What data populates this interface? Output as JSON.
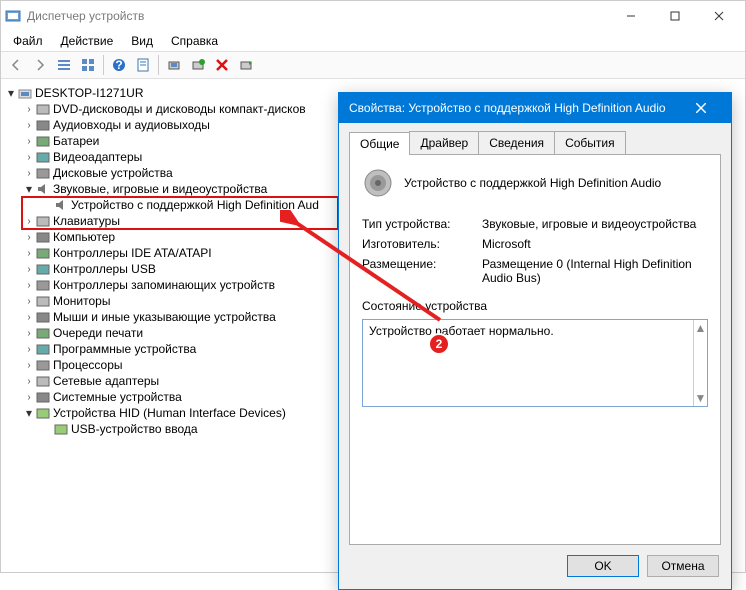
{
  "window": {
    "title": "Диспетчер устройств"
  },
  "menu": {
    "file": "Файл",
    "action": "Действие",
    "view": "Вид",
    "help": "Справка"
  },
  "tree": {
    "root": "DESKTOP-I1271UR",
    "items": [
      "DVD-дисководы и дисководы компакт-дисков",
      "Аудиовходы и аудиовыходы",
      "Батареи",
      "Видеоадаптеры",
      "Дисковые устройства"
    ],
    "sound_group": "Звуковые, игровые и видеоустройства",
    "sound_child": "Устройство с поддержкой High Definition Aud",
    "items2": [
      "Клавиатуры",
      "Компьютер",
      "Контроллеры IDE ATA/ATAPI",
      "Контроллеры USB",
      "Контроллеры запоминающих устройств",
      "Мониторы",
      "Мыши и иные указывающие устройства",
      "Очереди печати",
      "Программные устройства",
      "Процессоры",
      "Сетевые адаптеры",
      "Системные устройства"
    ],
    "hid": "Устройства HID (Human Interface Devices)",
    "hid_child": "USB-устройство ввода"
  },
  "dlg": {
    "title": "Свойства: Устройство с поддержкой High Definition Audio",
    "tabs": {
      "general": "Общие",
      "driver": "Драйвер",
      "details": "Сведения",
      "events": "События"
    },
    "device_name": "Устройство с поддержкой High Definition Audio",
    "labels": {
      "type": "Тип устройства:",
      "mfg": "Изготовитель:",
      "loc": "Размещение:",
      "status_h": "Состояние устройства"
    },
    "values": {
      "type": "Звуковые, игровые и видеоустройства",
      "mfg": "Microsoft",
      "loc": "Размещение 0 (Internal High Definition Audio Bus)"
    },
    "status_text": "Устройство работает нормально.",
    "ok": "OK",
    "cancel": "Отмена"
  },
  "badge": "2"
}
